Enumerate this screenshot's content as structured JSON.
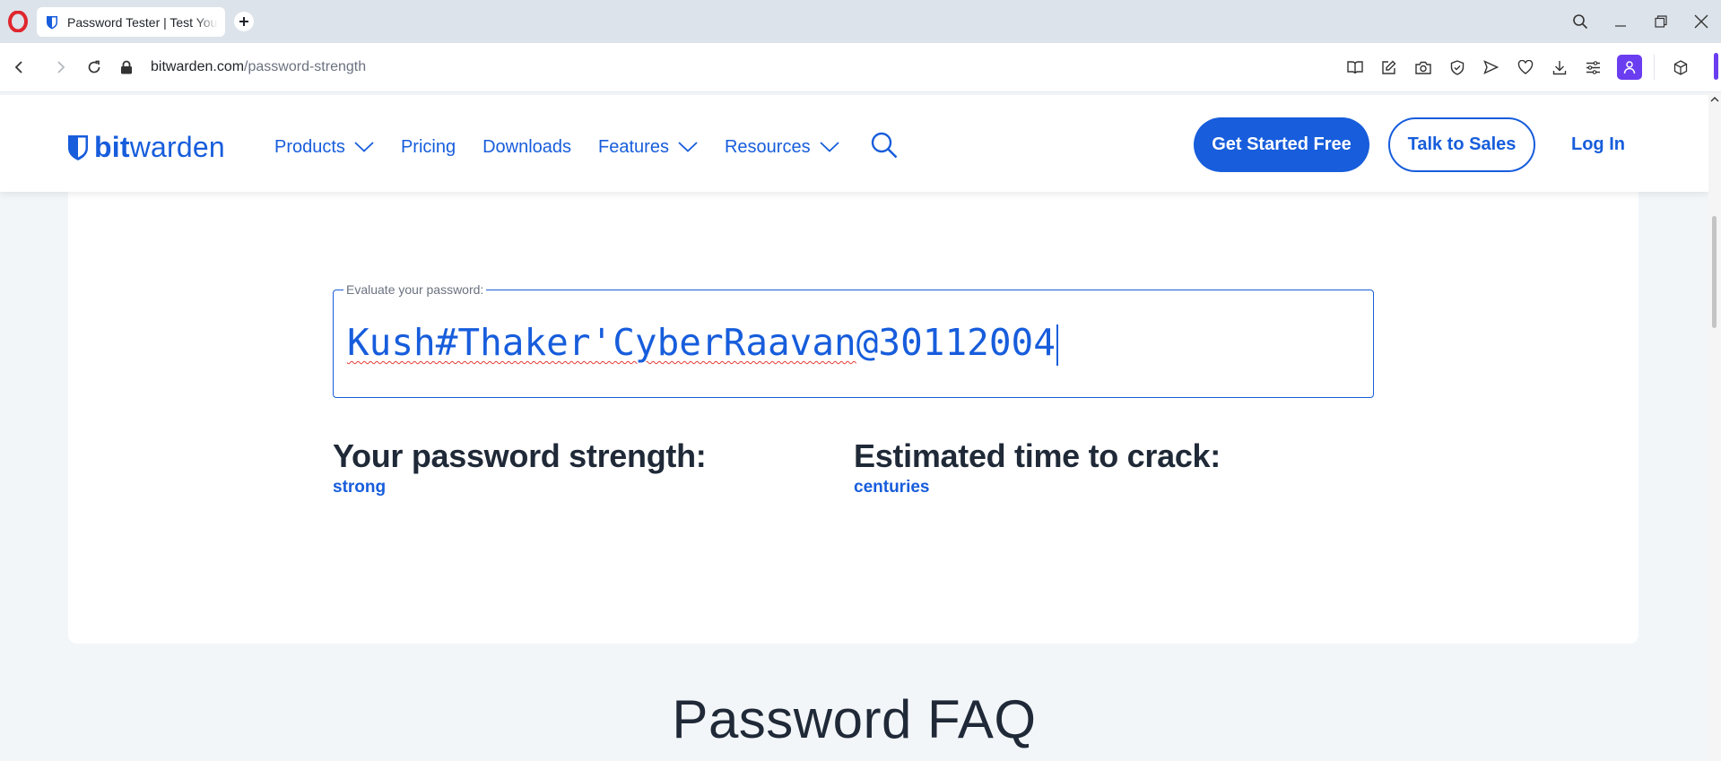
{
  "browser": {
    "tab_title": "Password Tester | Test Your Password Strength",
    "url_host": "bitwarden.com",
    "url_path": "/password-strength",
    "icons": [
      "opera-logo",
      "back",
      "forward",
      "reload",
      "lock",
      "reader",
      "edit",
      "camera",
      "adblock-shield",
      "send",
      "heart",
      "download",
      "easy-setup",
      "profile",
      "extensions"
    ]
  },
  "site": {
    "brand_bold": "bit",
    "brand_light": "warden",
    "nav": {
      "products": "Products",
      "pricing": "Pricing",
      "downloads": "Downloads",
      "features": "Features",
      "resources": "Resources"
    },
    "cta_primary": "Get Started Free",
    "cta_secondary": "Talk to Sales",
    "login": "Log In",
    "accent_color": "#175ddc"
  },
  "tester": {
    "label": "Evaluate your password:",
    "password_misspelled": "Kush#Thaker'CyberRaavan",
    "password_rest": "@30112004",
    "strength_heading": "Your password strength:",
    "strength_value": "strong",
    "crack_heading": "Estimated time to crack:",
    "crack_value": "centuries"
  },
  "faq": {
    "title": "Password FAQ"
  }
}
